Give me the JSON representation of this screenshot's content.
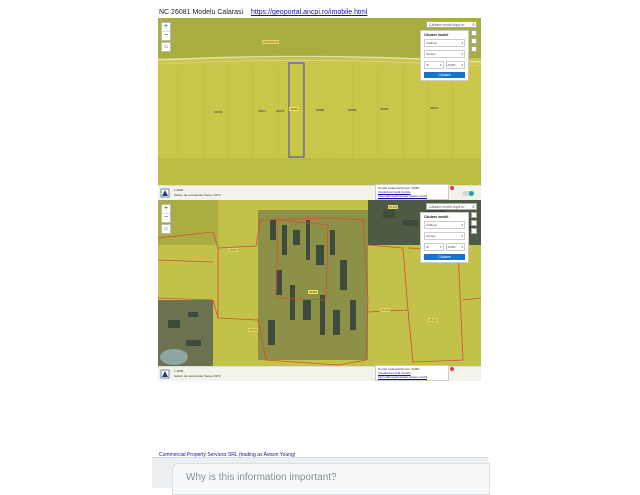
{
  "header": {
    "title": "NC 26081 Modelu Calarasi",
    "link": "https://geoportal.ancpi.ro/imobile.html"
  },
  "map_common": {
    "zoom_in": "+",
    "zoom_out": "−",
    "home": "⌂",
    "search_placeholder": "Căutare imobil după nr.",
    "panel_title": "Căutare imobil",
    "county_select": "Călărași",
    "uat_select": "Modelu",
    "id_select": "ID",
    "id_value": "26081",
    "search_button": "Căutare",
    "scale_text": "1:4000",
    "credit_text": "Sistem de coordonate Stereo 1970",
    "info_title": "Număr cadastral/funciar: 26081",
    "info_link1": "Vizualizare hartă imobile",
    "info_link2": "Informații suplimentare despre imobil"
  },
  "map1": {
    "parcel_label": "26081",
    "top_label": "26079/IE35",
    "parcel_numbers": [
      "26063",
      "26071",
      "26075",
      "26085",
      "26089",
      "26093",
      "26097"
    ]
  },
  "map2": {
    "labels": [
      "26081",
      "26047",
      "26105",
      "26121",
      "26033",
      "26129"
    ]
  },
  "footer": {
    "company": "Commercial Property Services SRL (trading as Avison Young)",
    "question": "Why is this information important?"
  },
  "colors": {
    "field_yellow": "#c8c948",
    "parcel_outline": "#5a5aa6",
    "boundary_red": "#d84a3a",
    "link_blue": "#1a0dab",
    "button_blue": "#1a73c8"
  }
}
